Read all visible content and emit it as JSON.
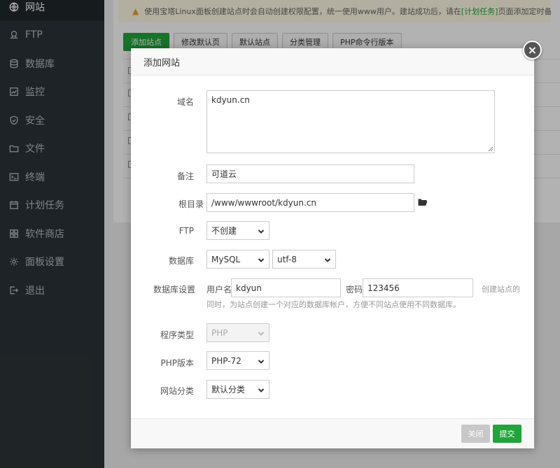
{
  "sidebar": {
    "items": [
      {
        "label": "网站",
        "icon": "globe-icon",
        "active": true
      },
      {
        "label": "FTP",
        "icon": "ftp-icon"
      },
      {
        "label": "数据库",
        "icon": "database-icon"
      },
      {
        "label": "监控",
        "icon": "monitor-icon"
      },
      {
        "label": "安全",
        "icon": "shield-icon"
      },
      {
        "label": "文件",
        "icon": "folder-icon"
      },
      {
        "label": "终端",
        "icon": "terminal-icon"
      },
      {
        "label": "计划任务",
        "icon": "calendar-icon"
      },
      {
        "label": "软件商店",
        "icon": "grid-icon"
      },
      {
        "label": "面板设置",
        "icon": "gear-icon"
      },
      {
        "label": "退出",
        "icon": "logout-icon"
      }
    ]
  },
  "notice": {
    "text_before": "使用宝塔Linux面板创建站点时会自动创建权限配置，统一使用www用户。建站成功后，请在",
    "link": "[计划任务]",
    "text_after": "页面添加定时备份任"
  },
  "toolbar": {
    "buttons": [
      "添加站点",
      "修改默认页",
      "默认站点",
      "分类管理",
      "PHP命令行版本"
    ]
  },
  "modal": {
    "title": "添加网站",
    "close_symbol": "×",
    "domain": {
      "label": "域名",
      "value": "kdyun.cn"
    },
    "remark": {
      "label": "备注",
      "value": "可道云"
    },
    "root": {
      "label": "根目录",
      "value": "/www/wwwroot/kdyun.cn"
    },
    "ftp": {
      "label": "FTP",
      "value": "不创建"
    },
    "database": {
      "label": "数据库",
      "type": "MySQL",
      "charset": "utf-8"
    },
    "db_settings": {
      "label": "数据库设置",
      "user_label": "用户名",
      "user_value": "kdyun",
      "pass_label": "密码",
      "pass_value": "123456",
      "hint_right": "创建站点的",
      "hint_below": "同时，为站点创建一个对应的数据库帐户，方便不同站点使用不同数据库。"
    },
    "program_type": {
      "label": "程序类型",
      "value": "PHP"
    },
    "php_version": {
      "label": "PHP版本",
      "value": "PHP-72"
    },
    "site_category": {
      "label": "网站分类",
      "value": "默认分类"
    },
    "footer": {
      "close_label": "关闭",
      "submit_label": "提交"
    }
  },
  "colors": {
    "accent": "#20a53a",
    "sidebar_bg": "#2c3338",
    "close_btn": "#c8c8c8"
  }
}
